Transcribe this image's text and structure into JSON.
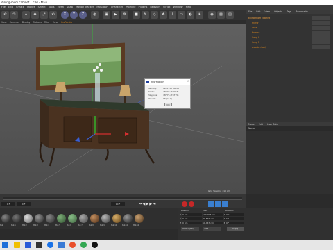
{
  "window": {
    "title": "dining-room cabinet ...c4d - Main"
  },
  "menubar": {
    "items": [
      "File",
      "Edit",
      "Create",
      "Modes",
      "Select",
      "Tools",
      "Mesh",
      "Snap",
      "Motion Tracker",
      "MoGraph",
      "Character",
      "Pipeline",
      "Plugins",
      "Redshift",
      "Script",
      "Window",
      "Help"
    ]
  },
  "toolbar": {
    "axes": [
      "X",
      "Y",
      "Z"
    ]
  },
  "viewport": {
    "menu": [
      "View",
      "Cameras",
      "Display",
      "Options",
      "Filter",
      "Panel",
      "ProRender"
    ],
    "grid_spacing": "Grid Spacing : 10 cm"
  },
  "object_manager": {
    "menu": [
      "File",
      "Edit",
      "View",
      "Objects",
      "Tags",
      "Bookmarks"
    ],
    "objects": [
      "dining-room cabinet",
      "mirror",
      "vase",
      "flowers",
      "lamp L",
      "lamp R",
      "wooden body"
    ]
  },
  "attribute_manager": {
    "menu": [
      "Mode",
      "Edit",
      "User Data"
    ],
    "name_label": "Name"
  },
  "timeline": {
    "start": "0 F",
    "end": "90 F",
    "current": "0 F"
  },
  "materials": {
    "labels": [
      "Mat",
      "Mat.1",
      "Mat.2",
      "Mat.3",
      "Mat.4",
      "Mat.5",
      "Mat.6",
      "Mat.7",
      "Mat.8",
      "Mat.9",
      "Mat.10",
      "Mat.11",
      "Mat.12"
    ]
  },
  "coordinates": {
    "headers": [
      "Position",
      "Size",
      "Rotation"
    ],
    "rows": [
      {
        "axis": "X",
        "pos": "0 cm",
        "size": "190.293 cm",
        "rot": "H 0 °"
      },
      {
        "axis": "Y",
        "pos": "0 cm",
        "size": "89.832 cm",
        "rot": "P 0 °"
      },
      {
        "axis": "Z",
        "pos": "0 cm",
        "size": "50.447 cm",
        "rot": "B 0 °"
      }
    ],
    "mode": "Object (Rel)",
    "size_mode": "Size",
    "apply": "Apply"
  },
  "dialog": {
    "title": "Information",
    "rows": [
      {
        "k": "Memory:",
        "v": "ca. 8750 KByte"
      },
      {
        "k": "Points:",
        "v": "78093 (78093)"
      },
      {
        "k": "Polygons:",
        "v": "78775 (78775)"
      },
      {
        "k": "Objects:",
        "v": "96 (117)"
      }
    ],
    "ok": "OK"
  },
  "colors": {
    "accent": "#e08a1e",
    "bg": "#2b2b2b"
  }
}
